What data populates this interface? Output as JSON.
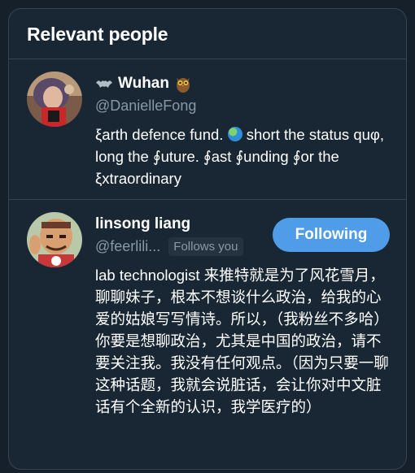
{
  "section": {
    "title": "Relevant people"
  },
  "people": [
    {
      "name_prefix_emoji": "bat",
      "display_name": "Wuhan",
      "name_suffix_emoji": "owl",
      "handle": "@DanielleFong",
      "bio_part1": "ξarth defence fund.",
      "bio_emoji": "globe",
      "bio_part2": "short the status quφ, long the ∮uture. ∮ast ∮unding ∮or the ξxtraordinary"
    },
    {
      "display_name": "linsong liang",
      "handle": "@feerlili...",
      "follows_you": "Follows you",
      "button_label": "Following",
      "bio": "lab technologist 来推特就是为了风花雪月，聊聊妹子，根本不想谈什么政治，给我的心爱的姑娘写写情诗。所以，（我粉丝不多哈）你要是想聊政治，尤其是中国的政治，请不要关注我。我没有任何观点。（因为只要一聊这种话题，我就会说脏话，会让你对中文脏话有个全新的认识，我学医疗的）"
    }
  ],
  "colors": {
    "background": "#15202b",
    "card": "#192734",
    "border": "#38444d",
    "accent": "#4f9de8",
    "secondary_text": "#8899a6"
  }
}
